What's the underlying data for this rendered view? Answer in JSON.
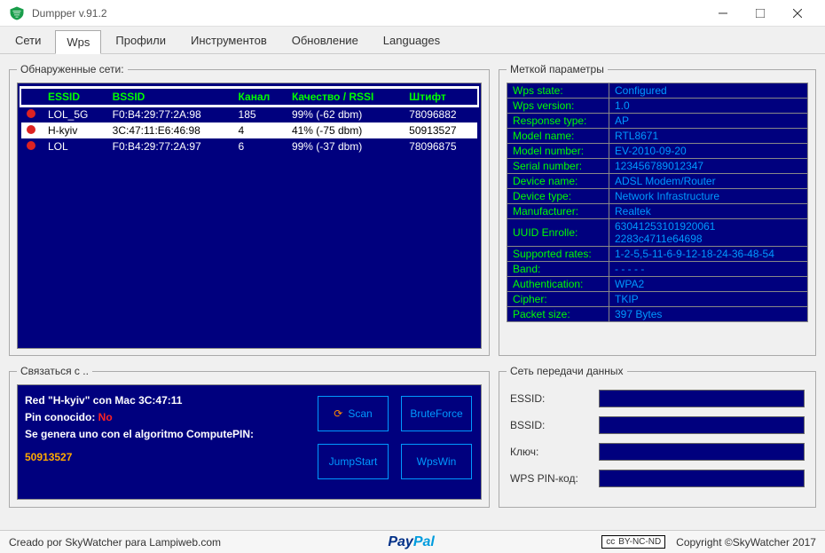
{
  "title": "Dumpper v.91.2",
  "tabs": [
    "Сети",
    "Wps",
    "Профили",
    "Инструментов",
    "Обновление",
    "Languages"
  ],
  "active_tab": 1,
  "detected": {
    "legend": "Обнаруженные сети:",
    "headers": [
      "ESSID",
      "BSSID",
      "Канал",
      "Качество / RSSI",
      "Штифт"
    ],
    "rows": [
      {
        "essid": "LOL_5G",
        "bssid": "F0:B4:29:77:2A:98",
        "channel": "185",
        "quality": "99% (-62 dbm)",
        "pin": "78096882"
      },
      {
        "essid": "H-kyiv",
        "bssid": "3C:47:11:E6:46:98",
        "channel": "4",
        "quality": "41% (-75 dbm)",
        "pin": "50913527"
      },
      {
        "essid": "LOL",
        "bssid": "F0:B4:29:77:2A:97",
        "channel": "6",
        "quality": "99% (-37 dbm)",
        "pin": "78096875"
      }
    ],
    "selected": 1
  },
  "details": {
    "legend": "Меткой параметры",
    "rows": [
      {
        "k": "Wps state:",
        "v": "Configured"
      },
      {
        "k": "Wps version:",
        "v": "1.0"
      },
      {
        "k": "Response type:",
        "v": "AP"
      },
      {
        "k": "Model name:",
        "v": "RTL8671"
      },
      {
        "k": "Model number:",
        "v": "EV-2010-09-20"
      },
      {
        "k": "Serial number:",
        "v": "123456789012347"
      },
      {
        "k": "Device name:",
        "v": "ADSL Modem/Router"
      },
      {
        "k": "Device type:",
        "v": "Network Infrastructure"
      },
      {
        "k": "Manufacturer:",
        "v": "Realtek"
      },
      {
        "k": "UUID Enrolle:",
        "v": "63041253101920061​2283c4711e64698"
      },
      {
        "k": "Supported rates:",
        "v": "1-2-5,5-11-6-9-12-18-24-36-48-54"
      },
      {
        "k": "Band:",
        "v": "- - - - -"
      },
      {
        "k": "Authentication:",
        "v": "WPA2"
      },
      {
        "k": "Cipher:",
        "v": "TKIP"
      },
      {
        "k": "Packet size:",
        "v": "397 Bytes"
      }
    ]
  },
  "connect": {
    "legend": "Связаться с ..",
    "line1": "Red \"H-kyiv\" con Mac 3C:47:11",
    "line2a": "Pin conocido: ",
    "line2b": "No",
    "line3": "Se genera uno con el algoritmo ComputePIN:",
    "pin": "50913527",
    "btns": [
      "Scan",
      "BruteForce",
      "JumpStart",
      "WpsWin"
    ]
  },
  "netdata": {
    "legend": "Сеть передачи данных",
    "labels": [
      "ESSID:",
      "BSSID:",
      "Ключ:",
      "WPS PIN-код:"
    ]
  },
  "status": {
    "left": "Creado por SkyWatcher para Lampiweb.com",
    "cc": "BY-NC-ND",
    "right": "Copyright ©SkyWatcher 2017"
  }
}
